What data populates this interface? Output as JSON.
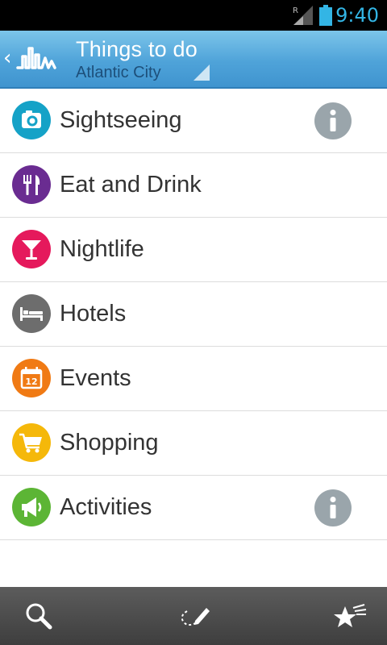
{
  "status_bar": {
    "time": "9:40",
    "roaming_indicator": "R",
    "icons": [
      "signal-roaming-icon",
      "battery-icon"
    ]
  },
  "action_bar": {
    "back_icon": "chevron-left-icon",
    "logo_icon": "city-skyline-logo-icon",
    "title": "Things to do",
    "subtitle": "Atlantic City"
  },
  "categories": [
    {
      "label": "Sightseeing",
      "icon": "camera-icon",
      "color": "#15a2c7",
      "has_info": true
    },
    {
      "label": "Eat and Drink",
      "icon": "fork-knife-icon",
      "color": "#6a2c91",
      "has_info": false
    },
    {
      "label": "Nightlife",
      "icon": "cocktail-icon",
      "color": "#e5195c",
      "has_info": false
    },
    {
      "label": "Hotels",
      "icon": "bed-icon",
      "color": "#6d6d6d",
      "has_info": false
    },
    {
      "label": "Events",
      "icon": "calendar-icon",
      "color": "#f07a14",
      "calendar_day": "12",
      "has_info": false
    },
    {
      "label": "Shopping",
      "icon": "shopping-cart-icon",
      "color": "#f5b80a",
      "has_info": false
    },
    {
      "label": "Activities",
      "icon": "megaphone-icon",
      "color": "#5cb535",
      "has_info": true
    }
  ],
  "bottom_bar": {
    "buttons": [
      "search-icon",
      "route-pencil-icon",
      "favorites-stars-icon"
    ]
  },
  "colors": {
    "status_time": "#33b5e5",
    "action_bar": "#4fa3d9",
    "subtitle": "#1d4f7a",
    "info_button": "#9aa5ab",
    "bottom_bar": "#4a4a4a"
  }
}
